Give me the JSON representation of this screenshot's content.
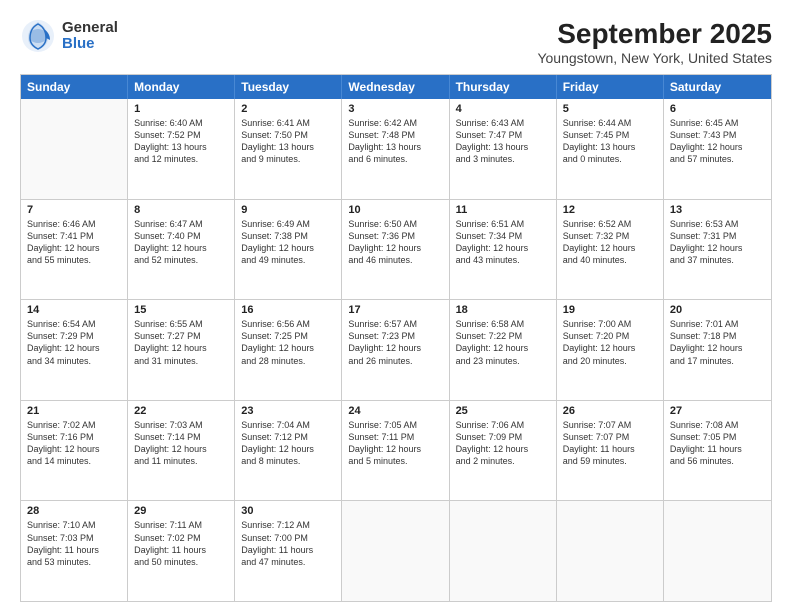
{
  "logo": {
    "general": "General",
    "blue": "Blue"
  },
  "title": "September 2025",
  "subtitle": "Youngstown, New York, United States",
  "days": [
    "Sunday",
    "Monday",
    "Tuesday",
    "Wednesday",
    "Thursday",
    "Friday",
    "Saturday"
  ],
  "rows": [
    [
      {
        "day": "",
        "lines": [],
        "empty": true
      },
      {
        "day": "1",
        "lines": [
          "Sunrise: 6:40 AM",
          "Sunset: 7:52 PM",
          "Daylight: 13 hours",
          "and 12 minutes."
        ]
      },
      {
        "day": "2",
        "lines": [
          "Sunrise: 6:41 AM",
          "Sunset: 7:50 PM",
          "Daylight: 13 hours",
          "and 9 minutes."
        ]
      },
      {
        "day": "3",
        "lines": [
          "Sunrise: 6:42 AM",
          "Sunset: 7:48 PM",
          "Daylight: 13 hours",
          "and 6 minutes."
        ]
      },
      {
        "day": "4",
        "lines": [
          "Sunrise: 6:43 AM",
          "Sunset: 7:47 PM",
          "Daylight: 13 hours",
          "and 3 minutes."
        ]
      },
      {
        "day": "5",
        "lines": [
          "Sunrise: 6:44 AM",
          "Sunset: 7:45 PM",
          "Daylight: 13 hours",
          "and 0 minutes."
        ]
      },
      {
        "day": "6",
        "lines": [
          "Sunrise: 6:45 AM",
          "Sunset: 7:43 PM",
          "Daylight: 12 hours",
          "and 57 minutes."
        ]
      }
    ],
    [
      {
        "day": "7",
        "lines": [
          "Sunrise: 6:46 AM",
          "Sunset: 7:41 PM",
          "Daylight: 12 hours",
          "and 55 minutes."
        ]
      },
      {
        "day": "8",
        "lines": [
          "Sunrise: 6:47 AM",
          "Sunset: 7:40 PM",
          "Daylight: 12 hours",
          "and 52 minutes."
        ]
      },
      {
        "day": "9",
        "lines": [
          "Sunrise: 6:49 AM",
          "Sunset: 7:38 PM",
          "Daylight: 12 hours",
          "and 49 minutes."
        ]
      },
      {
        "day": "10",
        "lines": [
          "Sunrise: 6:50 AM",
          "Sunset: 7:36 PM",
          "Daylight: 12 hours",
          "and 46 minutes."
        ]
      },
      {
        "day": "11",
        "lines": [
          "Sunrise: 6:51 AM",
          "Sunset: 7:34 PM",
          "Daylight: 12 hours",
          "and 43 minutes."
        ]
      },
      {
        "day": "12",
        "lines": [
          "Sunrise: 6:52 AM",
          "Sunset: 7:32 PM",
          "Daylight: 12 hours",
          "and 40 minutes."
        ]
      },
      {
        "day": "13",
        "lines": [
          "Sunrise: 6:53 AM",
          "Sunset: 7:31 PM",
          "Daylight: 12 hours",
          "and 37 minutes."
        ]
      }
    ],
    [
      {
        "day": "14",
        "lines": [
          "Sunrise: 6:54 AM",
          "Sunset: 7:29 PM",
          "Daylight: 12 hours",
          "and 34 minutes."
        ]
      },
      {
        "day": "15",
        "lines": [
          "Sunrise: 6:55 AM",
          "Sunset: 7:27 PM",
          "Daylight: 12 hours",
          "and 31 minutes."
        ]
      },
      {
        "day": "16",
        "lines": [
          "Sunrise: 6:56 AM",
          "Sunset: 7:25 PM",
          "Daylight: 12 hours",
          "and 28 minutes."
        ]
      },
      {
        "day": "17",
        "lines": [
          "Sunrise: 6:57 AM",
          "Sunset: 7:23 PM",
          "Daylight: 12 hours",
          "and 26 minutes."
        ]
      },
      {
        "day": "18",
        "lines": [
          "Sunrise: 6:58 AM",
          "Sunset: 7:22 PM",
          "Daylight: 12 hours",
          "and 23 minutes."
        ]
      },
      {
        "day": "19",
        "lines": [
          "Sunrise: 7:00 AM",
          "Sunset: 7:20 PM",
          "Daylight: 12 hours",
          "and 20 minutes."
        ]
      },
      {
        "day": "20",
        "lines": [
          "Sunrise: 7:01 AM",
          "Sunset: 7:18 PM",
          "Daylight: 12 hours",
          "and 17 minutes."
        ]
      }
    ],
    [
      {
        "day": "21",
        "lines": [
          "Sunrise: 7:02 AM",
          "Sunset: 7:16 PM",
          "Daylight: 12 hours",
          "and 14 minutes."
        ]
      },
      {
        "day": "22",
        "lines": [
          "Sunrise: 7:03 AM",
          "Sunset: 7:14 PM",
          "Daylight: 12 hours",
          "and 11 minutes."
        ]
      },
      {
        "day": "23",
        "lines": [
          "Sunrise: 7:04 AM",
          "Sunset: 7:12 PM",
          "Daylight: 12 hours",
          "and 8 minutes."
        ]
      },
      {
        "day": "24",
        "lines": [
          "Sunrise: 7:05 AM",
          "Sunset: 7:11 PM",
          "Daylight: 12 hours",
          "and 5 minutes."
        ]
      },
      {
        "day": "25",
        "lines": [
          "Sunrise: 7:06 AM",
          "Sunset: 7:09 PM",
          "Daylight: 12 hours",
          "and 2 minutes."
        ]
      },
      {
        "day": "26",
        "lines": [
          "Sunrise: 7:07 AM",
          "Sunset: 7:07 PM",
          "Daylight: 11 hours",
          "and 59 minutes."
        ]
      },
      {
        "day": "27",
        "lines": [
          "Sunrise: 7:08 AM",
          "Sunset: 7:05 PM",
          "Daylight: 11 hours",
          "and 56 minutes."
        ]
      }
    ],
    [
      {
        "day": "28",
        "lines": [
          "Sunrise: 7:10 AM",
          "Sunset: 7:03 PM",
          "Daylight: 11 hours",
          "and 53 minutes."
        ]
      },
      {
        "day": "29",
        "lines": [
          "Sunrise: 7:11 AM",
          "Sunset: 7:02 PM",
          "Daylight: 11 hours",
          "and 50 minutes."
        ]
      },
      {
        "day": "30",
        "lines": [
          "Sunrise: 7:12 AM",
          "Sunset: 7:00 PM",
          "Daylight: 11 hours",
          "and 47 minutes."
        ]
      },
      {
        "day": "",
        "lines": [],
        "empty": true
      },
      {
        "day": "",
        "lines": [],
        "empty": true
      },
      {
        "day": "",
        "lines": [],
        "empty": true
      },
      {
        "day": "",
        "lines": [],
        "empty": true
      }
    ]
  ]
}
